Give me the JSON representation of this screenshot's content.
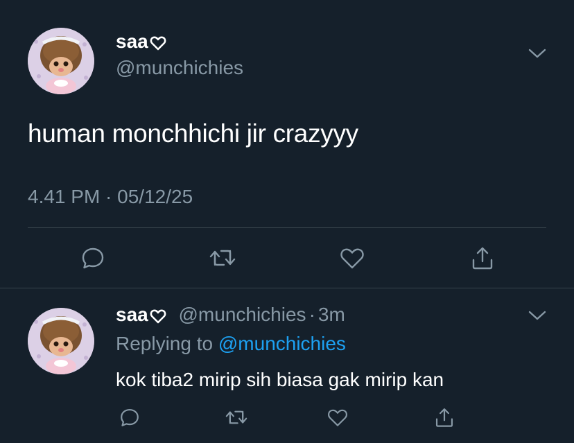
{
  "main_tweet": {
    "display_name": "saa",
    "handle": "@munchichies",
    "text": "human monchhichi jir crazyyy",
    "timestamp": "4.41 PM · 05/12/25"
  },
  "reply_tweet": {
    "display_name": "saa",
    "handle": "@munchichies",
    "separator": "·",
    "time_ago": "3m",
    "replying_label": "Replying to",
    "replying_mention": "@munchichies",
    "text": "kok tiba2 mirip sih biasa gak mirip kan"
  },
  "icons": {
    "reply": "comment-bubble-icon",
    "retweet": "retweet-icon",
    "like": "heart-icon",
    "share": "share-icon",
    "menu": "chevron-down-icon",
    "name_emoji": "white-heart-icon"
  },
  "colors": {
    "background": "#15202b",
    "secondary_text": "#8899a6",
    "link": "#1da1f2",
    "divider": "#38444d"
  }
}
